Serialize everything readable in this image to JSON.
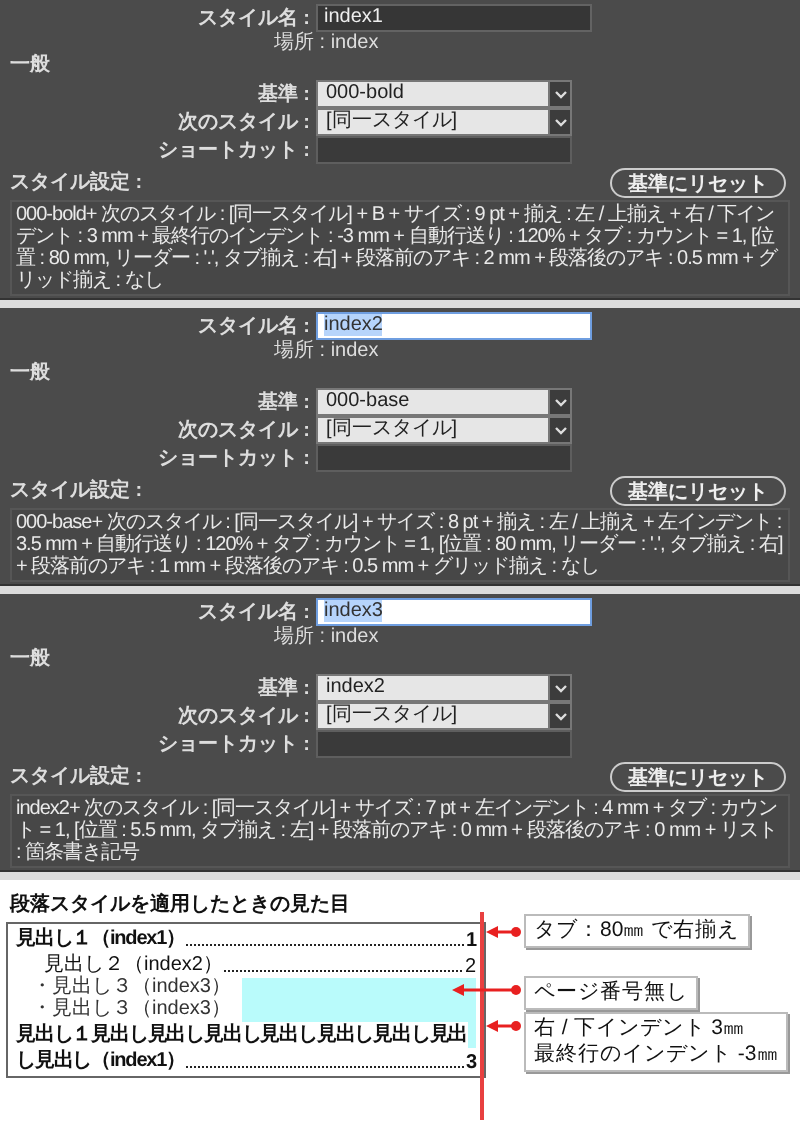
{
  "panels": [
    {
      "style_name": {
        "label": "スタイル名 :",
        "value": "index1",
        "active": false
      },
      "location": "場所 : index",
      "section": "一般",
      "fields": [
        {
          "kind": "select",
          "label": "基準 :",
          "value": "000-bold"
        },
        {
          "kind": "select",
          "label": "次のスタイル :",
          "value": "[同一スタイル]"
        },
        {
          "kind": "input",
          "label": "ショートカット :"
        }
      ],
      "settings_label": "スタイル設定 :",
      "reset_button": "基準にリセット",
      "description": "000-bold+ 次のスタイル : [同一スタイル] + B + サイズ : 9 pt + 揃え : 左 / 上揃え + 右 / 下インデント : 3 mm + 最終行のインデント : -3 mm + 自動行送り : 120% + タブ : カウント = 1, [位置 : 80 mm, リーダー : '.', タブ揃え : 右] + 段落前のアキ : 2 mm + 段落後のアキ : 0.5 mm + グリッド揃え : なし"
    },
    {
      "style_name": {
        "label": "スタイル名 :",
        "value": "index2",
        "active": true
      },
      "location": "場所 : index",
      "section": "一般",
      "fields": [
        {
          "kind": "select",
          "label": "基準 :",
          "value": "000-base"
        },
        {
          "kind": "select",
          "label": "次のスタイル :",
          "value": "[同一スタイル]"
        },
        {
          "kind": "input",
          "label": "ショートカット :"
        }
      ],
      "settings_label": "スタイル設定 :",
      "reset_button": "基準にリセット",
      "description": "000-base+ 次のスタイル : [同一スタイル] + サイズ : 8 pt + 揃え : 左 / 上揃え + 左インデント : 3.5 mm + 自動行送り : 120% + タブ : カウント = 1, [位置 : 80 mm, リーダー : '.', タブ揃え : 右] + 段落前のアキ : 1 mm + 段落後のアキ : 0.5 mm + グリッド揃え : なし"
    },
    {
      "style_name": {
        "label": "スタイル名 :",
        "value": "index3",
        "active": true
      },
      "location": "場所 : index",
      "section": "一般",
      "fields": [
        {
          "kind": "select",
          "label": "基準 :",
          "value": "index2"
        },
        {
          "kind": "select",
          "label": "次のスタイル :",
          "value": "[同一スタイル]"
        },
        {
          "kind": "input",
          "label": "ショートカット :"
        }
      ],
      "settings_label": "スタイル設定 :",
      "reset_button": "基準にリセット",
      "description": "index2+ 次のスタイル : [同一スタイル] + サイズ : 7 pt + 左インデント : 4 mm + タブ : カウント = 1, [位置 : 5.5 mm, タブ揃え : 左] + 段落前のアキ : 0 mm + 段落後のアキ : 0 mm + リスト : 箇条書き記号"
    }
  ],
  "preview": {
    "title": "段落スタイルを適用したときの見た目",
    "entries": [
      {
        "kind": "level1",
        "lines": [
          "見出し１（index1）"
        ],
        "page": "1"
      },
      {
        "kind": "level2",
        "lines": [
          "見出し２（index2）"
        ],
        "page": "2"
      },
      {
        "kind": "level3",
        "lines": [
          "・見出し３（index3）"
        ]
      },
      {
        "kind": "level3",
        "lines": [
          "・見出し３（index3）"
        ]
      },
      {
        "kind": "level1",
        "lines": [
          "見出し１見出し見出し見出し見出し見出し見出し見出",
          "し見出し（index1）"
        ],
        "page": "3"
      }
    ],
    "callouts": [
      {
        "lines": [
          "タブ：80㎜ で右揃え"
        ]
      },
      {
        "lines": [
          "ページ番号無し"
        ]
      },
      {
        "lines": [
          "右 / 下インデント 3㎜",
          "最終行のインデント -3㎜"
        ]
      }
    ]
  }
}
